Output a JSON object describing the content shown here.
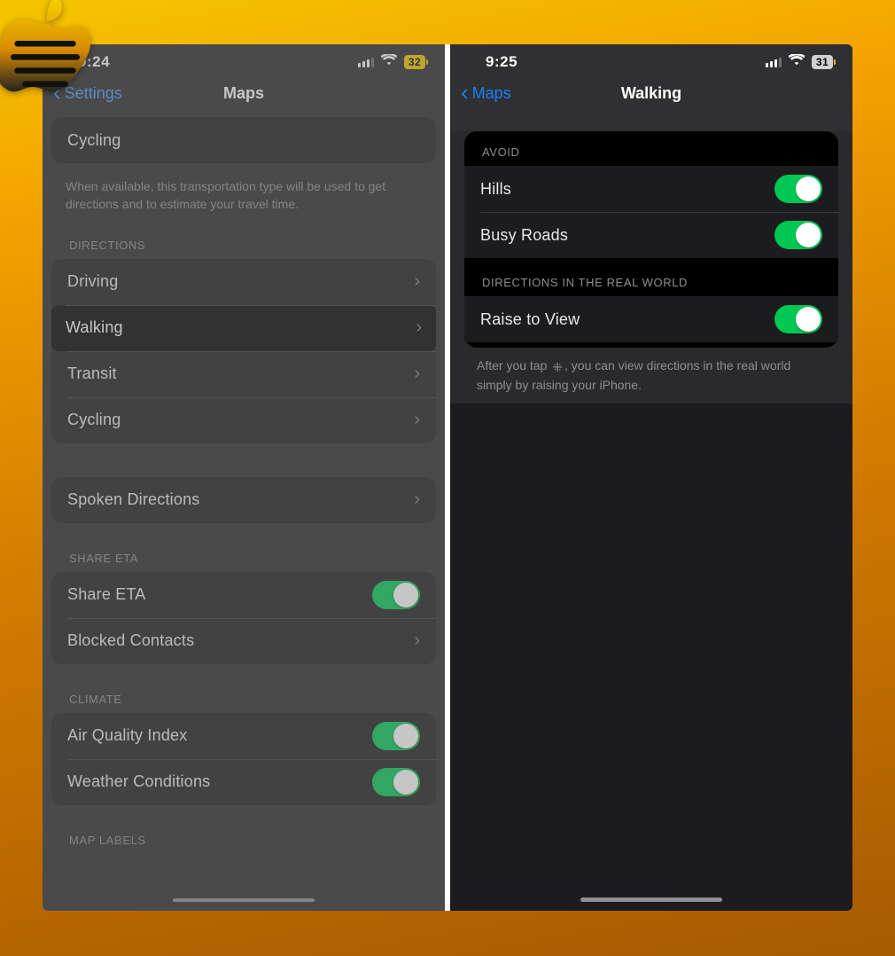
{
  "left": {
    "status": {
      "time": "9:24",
      "battery": "32"
    },
    "nav": {
      "back": "Settings",
      "title": "Maps"
    },
    "topRow": {
      "label": "Cycling"
    },
    "topFootnote": "When available, this transportation type will be used to get directions and to estimate your travel time.",
    "sections": {
      "directions": {
        "header": "DIRECTIONS",
        "items": [
          {
            "label": "Driving",
            "highlight": false
          },
          {
            "label": "Walking",
            "highlight": true
          },
          {
            "label": "Transit",
            "highlight": false
          },
          {
            "label": "Cycling",
            "highlight": false
          }
        ]
      },
      "spoken": {
        "label": "Spoken Directions"
      },
      "shareEta": {
        "header": "SHARE ETA",
        "items": [
          {
            "label": "Share ETA",
            "toggle": true
          },
          {
            "label": "Blocked Contacts",
            "disclosure": true
          }
        ]
      },
      "climate": {
        "header": "CLIMATE",
        "items": [
          {
            "label": "Air Quality Index",
            "toggle": true
          },
          {
            "label": "Weather Conditions",
            "toggle": true
          }
        ]
      },
      "mapLabels": {
        "header": "MAP LABELS"
      }
    }
  },
  "right": {
    "status": {
      "time": "9:25",
      "battery": "31"
    },
    "nav": {
      "back": "Maps",
      "title": "Walking"
    },
    "avoid": {
      "header": "AVOID",
      "items": [
        {
          "label": "Hills",
          "toggle": true
        },
        {
          "label": "Busy Roads",
          "toggle": true
        }
      ]
    },
    "realworld": {
      "header": "DIRECTIONS IN THE REAL WORLD",
      "items": [
        {
          "label": "Raise to View",
          "toggle": true
        }
      ],
      "footnote_a": "After you tap ",
      "footnote_b": ", you can view directions in the real world simply by raising your iPhone."
    }
  }
}
